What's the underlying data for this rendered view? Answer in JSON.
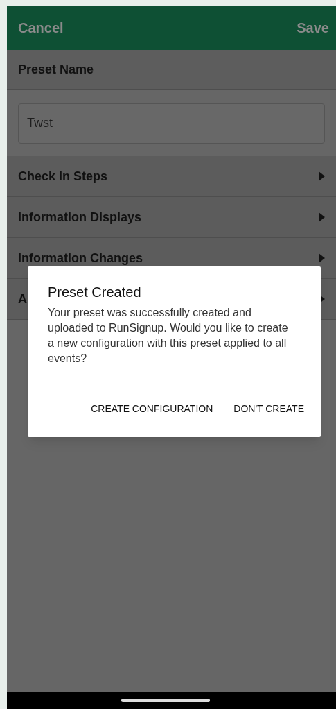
{
  "header": {
    "cancel": "Cancel",
    "save": "Save"
  },
  "preset_name": {
    "label": "Preset Name",
    "value": "Twst"
  },
  "sections": [
    {
      "label": "Check In Steps"
    },
    {
      "label": "Information Displays"
    },
    {
      "label": "Information Changes"
    },
    {
      "label": "A"
    }
  ],
  "dialog": {
    "title": "Preset Created",
    "message": "Your preset was successfully created and uploaded to RunSignup. Would you like to create a new configuration with this preset applied to all events?",
    "buttons": [
      "CREATE CONFIGURATION",
      "DON'T CREATE"
    ]
  }
}
